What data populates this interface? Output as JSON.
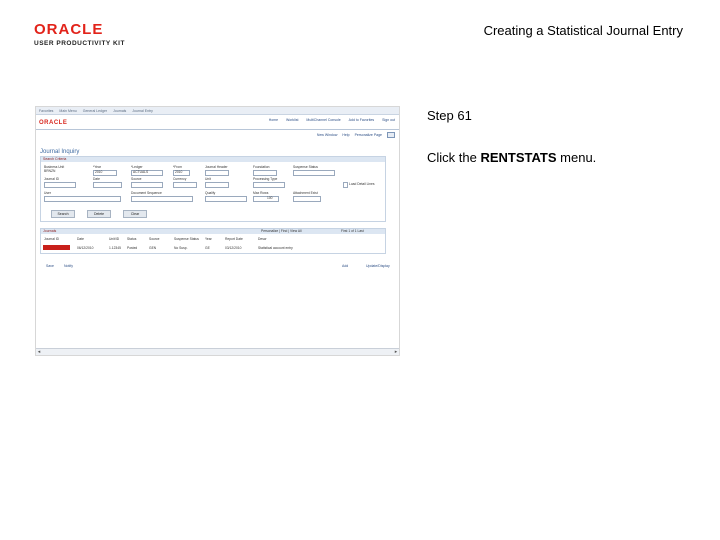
{
  "logo": {
    "brand": "ORACLE",
    "sub": "USER PRODUCTIVITY KIT"
  },
  "slide_title": "Creating a Statistical Journal Entry",
  "step": "Step 61",
  "instruction": {
    "prefix": "Click the ",
    "target": "RENTSTATS",
    "suffix": " menu."
  },
  "screenshot": {
    "nav": [
      "Favorites",
      "Main Menu",
      "General Ledger",
      "Journals",
      "Journal Entry"
    ],
    "brand": "ORACLE",
    "header_links": [
      "Home",
      "Worklist",
      "MultiChannel Console",
      "Add to Favorites",
      "Sign out"
    ],
    "toolbar": [
      "New Window",
      "Help",
      "Personalize Page"
    ],
    "page_title": "Journal Inquiry",
    "panel_title": "Search Criteria",
    "fields": [
      {
        "label": "Business Unit",
        "value": "BRNZN"
      },
      {
        "label": "*Year",
        "value": "2010"
      },
      {
        "label": "*Ledger",
        "value": "ACTUALS"
      },
      {
        "label": "*From",
        "value": "2010"
      },
      {
        "label": "Journal Header",
        "value": ""
      },
      {
        "label": "Foundation",
        "value": ""
      },
      {
        "label": "Suspense Status",
        "value": ""
      },
      {
        "label": "Journal ID",
        "value": ""
      },
      {
        "label": "Date",
        "value": ""
      },
      {
        "label": "Source",
        "value": ""
      },
      {
        "label": "Currency",
        "value": ""
      },
      {
        "label": "Unit",
        "value": ""
      },
      {
        "label": "Processing Type",
        "value": ""
      },
      {
        "label": "User",
        "value": ""
      },
      {
        "label": "Document Sequence",
        "value": ""
      },
      {
        "label": "Qualify",
        "value": ""
      },
      {
        "label": "Max Rows",
        "value": "100"
      },
      {
        "label": "Attachment Exist",
        "value": ""
      }
    ],
    "checkbox_label": "Load Detail Lines",
    "buttons": [
      "Search",
      "Delete",
      "Clear"
    ],
    "grid_title": "Journals",
    "grid_nav": "Personalize | Find | View All",
    "grid_pager": "First 1 of 1 Last",
    "columns": [
      "Journal ID",
      "Date",
      "Unit/ID",
      "Status",
      "Source",
      "Suspense Status",
      "Year",
      "Report Date",
      "Descr"
    ],
    "row": [
      "RENTSTATS",
      "06/12/2010",
      "1.12345",
      "Posted",
      "GEN",
      "No Susp.",
      "GE",
      "03/12/2010",
      "Statistical account entry"
    ],
    "bottom_links": [
      "Save",
      "Notify"
    ],
    "bottom_right": [
      "Add",
      "Update/Display"
    ]
  }
}
